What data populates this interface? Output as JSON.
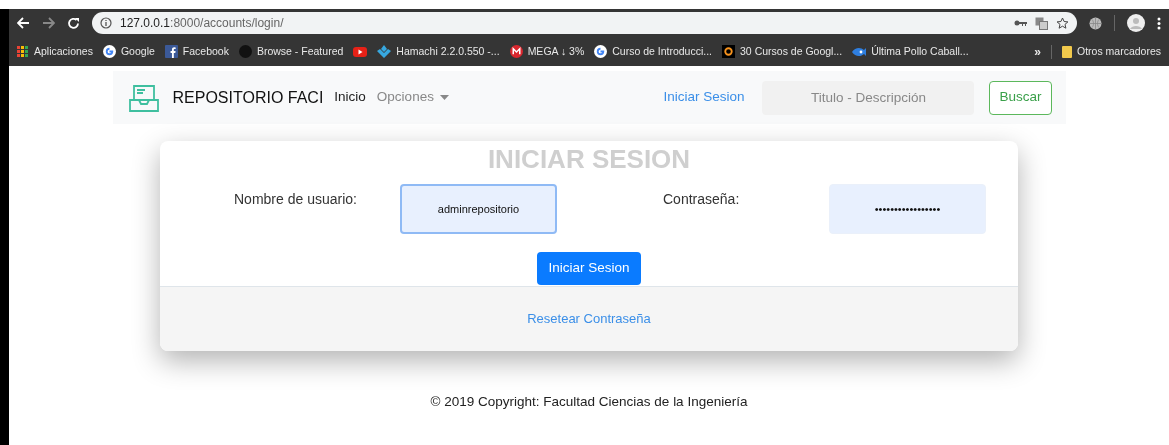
{
  "browser": {
    "url_host": "127.0.0.1",
    "url_path": ":8000/accounts/login/",
    "bookmarks": [
      {
        "kind": "apps",
        "label": "Aplicaciones"
      },
      {
        "kind": "google",
        "label": "Google"
      },
      {
        "kind": "facebook",
        "label": "Facebook"
      },
      {
        "kind": "disc",
        "label": "Browse - Featured"
      },
      {
        "kind": "play"
      },
      {
        "kind": "diamond",
        "label": "Hamachi 2.2.0.550 -..."
      },
      {
        "kind": "mega",
        "label": "MEGA ↓ 3%"
      },
      {
        "kind": "google",
        "label": "Curso de Introducci..."
      },
      {
        "kind": "ring",
        "label": "30 Cursos de Googl..."
      },
      {
        "kind": "fish",
        "label": "Última Pollo Caball..."
      }
    ],
    "overflow": "»",
    "other_bookmarks": "Otros marcadores"
  },
  "navbar": {
    "brand": "REPOSITORIO FACI",
    "links": [
      {
        "label": "Inicio",
        "kind": "link"
      },
      {
        "label": "Opciones",
        "kind": "dropdown"
      }
    ],
    "login_link": "Iniciar Sesion",
    "search": {
      "placeholder": "Titulo - Descripción"
    },
    "search_button": "Buscar"
  },
  "login": {
    "title": "INICIAR SESION",
    "fields": [
      {
        "label": "Nombre de usuario:",
        "value": "adminrepositorio",
        "focused": true
      },
      {
        "label": "Contraseña:",
        "value": "•••••••••••••••••",
        "focused": false
      }
    ],
    "submit": "Iniciar Sesion",
    "reset_link": "Resetear Contraseña"
  },
  "footer": "© 2019 Copyright: Facultad Ciencias de la Ingeniería"
}
